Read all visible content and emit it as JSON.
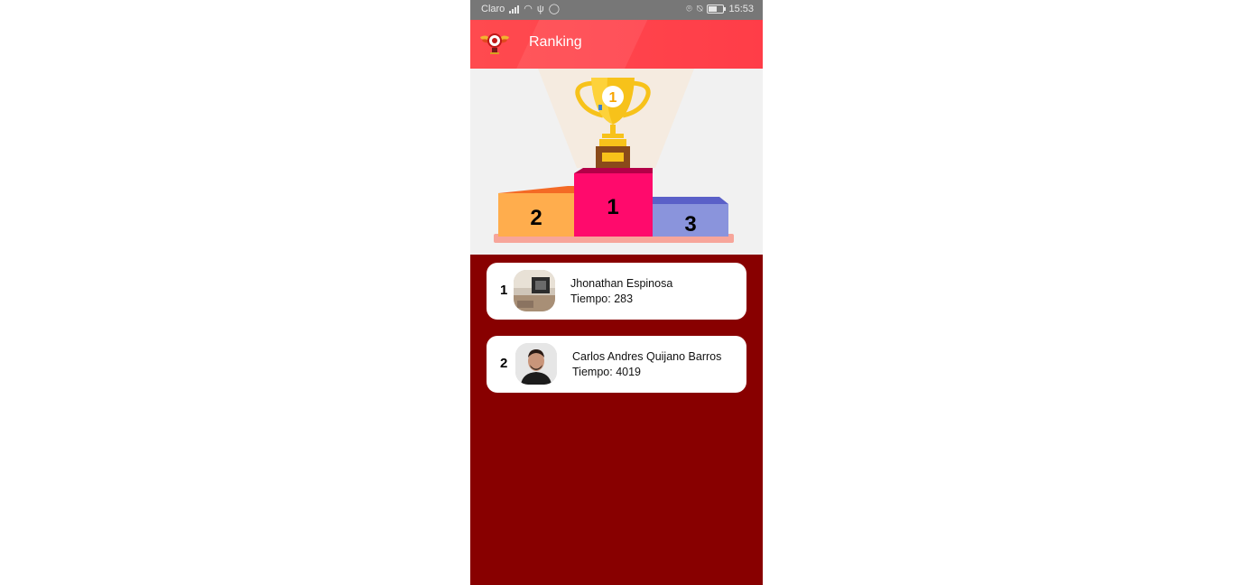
{
  "status_bar": {
    "carrier": "Claro",
    "time": "15:53",
    "icons": [
      "signal-icon",
      "wifi-icon",
      "usb-icon",
      "whatsapp-icon",
      "location-icon",
      "silent-icon",
      "battery-icon"
    ]
  },
  "app_bar": {
    "title": "Ranking",
    "logo_icon": "winged-logo-icon"
  },
  "podium": {
    "trophy_number": "1",
    "places": [
      {
        "label": "1",
        "color": "#ff0a6c"
      },
      {
        "label": "2",
        "color": "#ffad4d"
      },
      {
        "label": "3",
        "color": "#8a94dc"
      }
    ]
  },
  "ranking": [
    {
      "position": "1",
      "name": "Jhonathan Espinosa",
      "time_label": "Tiempo:",
      "time_value": "283"
    },
    {
      "position": "2",
      "name": "Carlos Andres Quijano Barros",
      "time_label": "Tiempo:",
      "time_value": "4019"
    }
  ],
  "colors": {
    "app_bar": "#ff4a4f",
    "list_background": "#880000",
    "hero_background": "#f1f1f1",
    "card": "#ffffff"
  }
}
